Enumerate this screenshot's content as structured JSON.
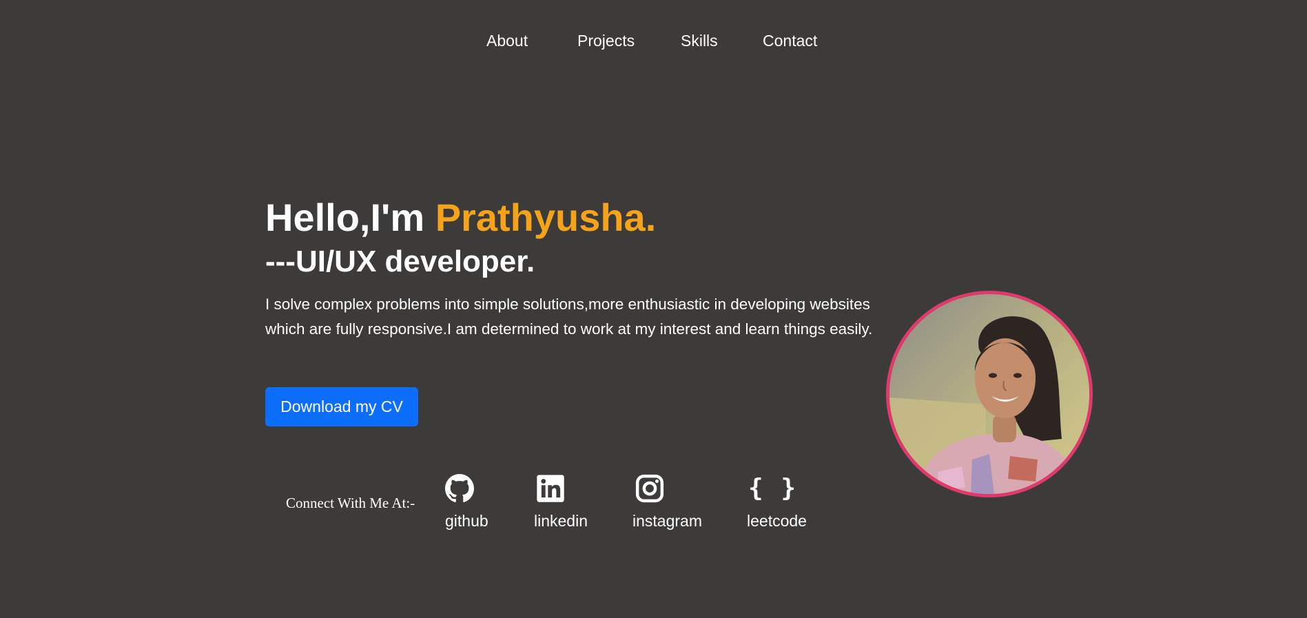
{
  "nav": {
    "items": [
      {
        "label": "About"
      },
      {
        "label": "Projects"
      },
      {
        "label": "Skills"
      },
      {
        "label": "Contact"
      }
    ]
  },
  "hero": {
    "greeting": "Hello,I'm ",
    "name": "Prathyusha.",
    "role": "---UI/UX developer.",
    "bio": "I solve complex problems into simple solutions,more enthusiastic in developing websites which are fully responsive.I am determined to work at my interest and learn things easily.",
    "cv_button_label": "Download my CV"
  },
  "connect": {
    "label": "Connect With Me At:-",
    "links": [
      {
        "label": "github",
        "icon": "github-icon"
      },
      {
        "label": "linkedin",
        "icon": "linkedin-icon"
      },
      {
        "label": "instagram",
        "icon": "instagram-icon"
      },
      {
        "label": "leetcode",
        "icon": "braces-icon"
      }
    ]
  },
  "colors": {
    "background": "#3d3b3a",
    "accent": "#f5a31a",
    "button": "#0d6efd",
    "avatar_border": "#de3b6c"
  }
}
